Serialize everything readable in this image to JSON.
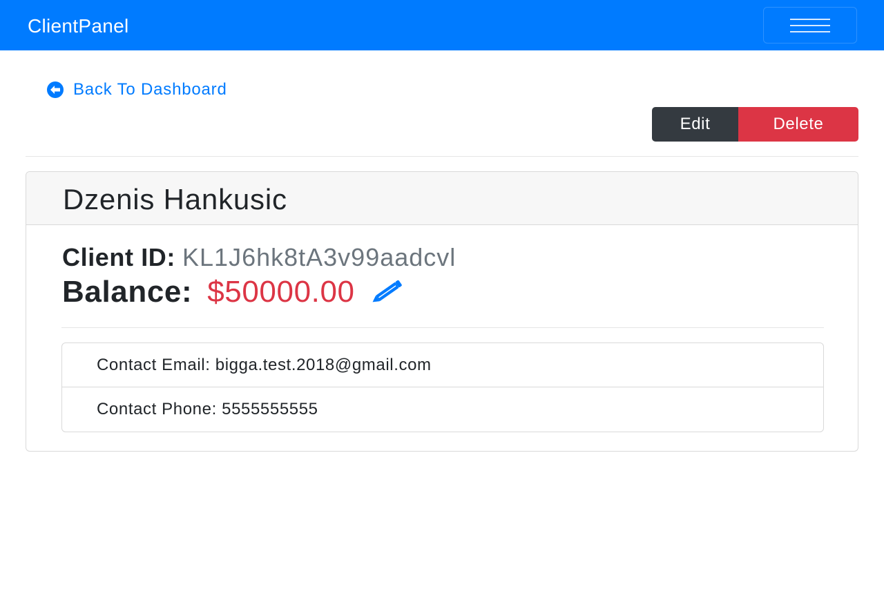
{
  "navbar": {
    "brand": "ClientPanel",
    "toggler_icon": "hamburger-icon",
    "background": "#007bff"
  },
  "back_link": {
    "icon": "arrow-circle-left-icon",
    "label": "Back To Dashboard"
  },
  "actions": {
    "edit_label": "Edit",
    "delete_label": "Delete",
    "edit_color": "#343a40",
    "delete_color": "#dc3545"
  },
  "client": {
    "name": "Dzenis Hankusic",
    "id_label": "Client ID:",
    "id_value": "KL1J6hk8tA3v99aadcvl",
    "balance_label": "Balance:",
    "balance_value": "$50000.00",
    "balance_color": "#dc3545",
    "balance_edit_icon": "pencil-icon"
  },
  "contact": {
    "email_label": "Contact Email:",
    "email_value": "bigga.test.2018@gmail.com",
    "phone_label": "Contact Phone:",
    "phone_value": "5555555555"
  }
}
